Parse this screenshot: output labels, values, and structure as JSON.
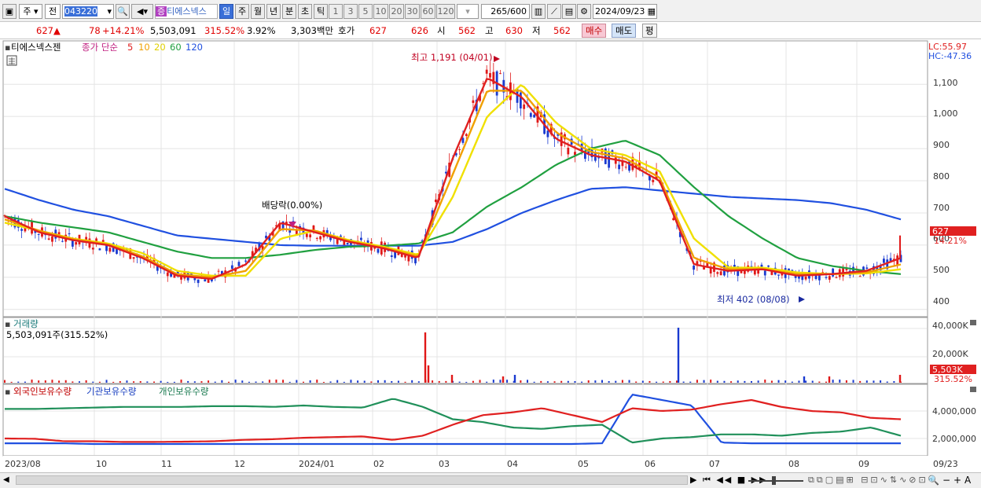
{
  "toolbar": {
    "period_select": "주",
    "market_select": "전",
    "code": "043220",
    "stock_name": "티에스넥스",
    "name_badge": "증",
    "periods": [
      "일",
      "주",
      "월",
      "년",
      "분",
      "초",
      "틱"
    ],
    "active_period": "일",
    "intervals": [
      "1",
      "3",
      "5",
      "10",
      "20",
      "30",
      "60",
      "120"
    ],
    "count": "265",
    "count_max": "/600",
    "date": "2024/09/23"
  },
  "quote": {
    "price": "627",
    "change_arrow": "▲",
    "change": "78",
    "change_rate": "+14.21%",
    "volume": "5,503,091",
    "volume_ratio": "315.52%",
    "turnover": "3.92%",
    "amount": "3,303백만",
    "hoga_label": "호가",
    "ask": "627",
    "bid": "626",
    "open_label": "시",
    "open": "562",
    "high_label": "고",
    "high": "630",
    "low_label": "저",
    "low": "562",
    "buy_label": "매수",
    "sell_label": "매도",
    "eval_label": "평"
  },
  "price_panel": {
    "stock_name": "티에스넥스젠",
    "legend_prefix": "종가 단순",
    "ma_labels": [
      "5",
      "10",
      "20",
      "60",
      "120"
    ],
    "ma_colors": [
      "#e02020",
      "#f0a000",
      "#f0e000",
      "#20a040",
      "#2050e0"
    ],
    "lc_label": "LC:55.97",
    "hc_label": "HC:-47.36",
    "high_annotation": "최고 1,191 (04/01)",
    "low_annotation": "최저 402 (08/08)",
    "dividend_annotation": "배당락(0.00%)",
    "current_price_tag": "627",
    "current_rate_tag": "14.21%",
    "y_ticks": [
      "1,100",
      "1,000",
      "900",
      "800",
      "700",
      "600",
      "500",
      "400"
    ]
  },
  "volume_panel": {
    "title": "거래량",
    "value_label": "5,503,091주(315.52%)",
    "y_ticks": [
      "40,000K",
      "20,000K"
    ],
    "current_tag": "5,503K",
    "current_rate": "315.52%"
  },
  "holding_panel": {
    "series_labels": [
      "외국인보유수량",
      "기관보유수량",
      "개인보유수량"
    ],
    "series_colors": [
      "#e02020",
      "#2050e0",
      "#20905a"
    ],
    "y_ticks": [
      "4,000,000",
      "2,000,000"
    ]
  },
  "x_axis": {
    "labels": [
      "2023/08",
      "10",
      "11",
      "12",
      "2024/01",
      "02",
      "03",
      "04",
      "05",
      "06",
      "07",
      "08",
      "09"
    ],
    "right_label": "09/23"
  },
  "chart_data": {
    "type": "line",
    "ylim": [
      380,
      1230
    ],
    "x_months": [
      "2023/08",
      "09",
      "10",
      "11",
      "12",
      "2024/01",
      "02",
      "03",
      "04",
      "05",
      "06",
      "07",
      "08",
      "09"
    ],
    "series": [
      {
        "name": "5",
        "values": [
          690,
          640,
          615,
          600,
          560,
          505,
          495,
          540,
          670,
          640,
          610,
          590,
          560,
          870,
          1120,
          1060,
          930,
          880,
          860,
          800,
          540,
          520,
          525,
          505,
          510,
          520,
          560
        ]
      },
      {
        "name": "10",
        "values": [
          680,
          645,
          618,
          602,
          565,
          510,
          500,
          520,
          650,
          645,
          612,
          592,
          565,
          820,
          1080,
          1080,
          950,
          890,
          870,
          810,
          560,
          525,
          525,
          510,
          510,
          515,
          540
        ]
      },
      {
        "name": "20",
        "values": [
          670,
          645,
          620,
          605,
          575,
          520,
          505,
          505,
          620,
          645,
          615,
          595,
          570,
          750,
          1000,
          1100,
          980,
          900,
          880,
          830,
          620,
          530,
          530,
          515,
          510,
          512,
          525
        ]
      },
      {
        "name": "60",
        "values": [
          690,
          670,
          655,
          640,
          610,
          580,
          560,
          560,
          570,
          585,
          595,
          598,
          605,
          640,
          720,
          780,
          850,
          900,
          925,
          880,
          780,
          690,
          620,
          560,
          535,
          520,
          510
        ]
      },
      {
        "name": "120",
        "values": [
          775,
          740,
          710,
          690,
          660,
          630,
          620,
          610,
          600,
          598,
          598,
          598,
          598,
          610,
          650,
          700,
          740,
          775,
          780,
          770,
          760,
          750,
          745,
          740,
          730,
          710,
          680
        ]
      }
    ]
  }
}
